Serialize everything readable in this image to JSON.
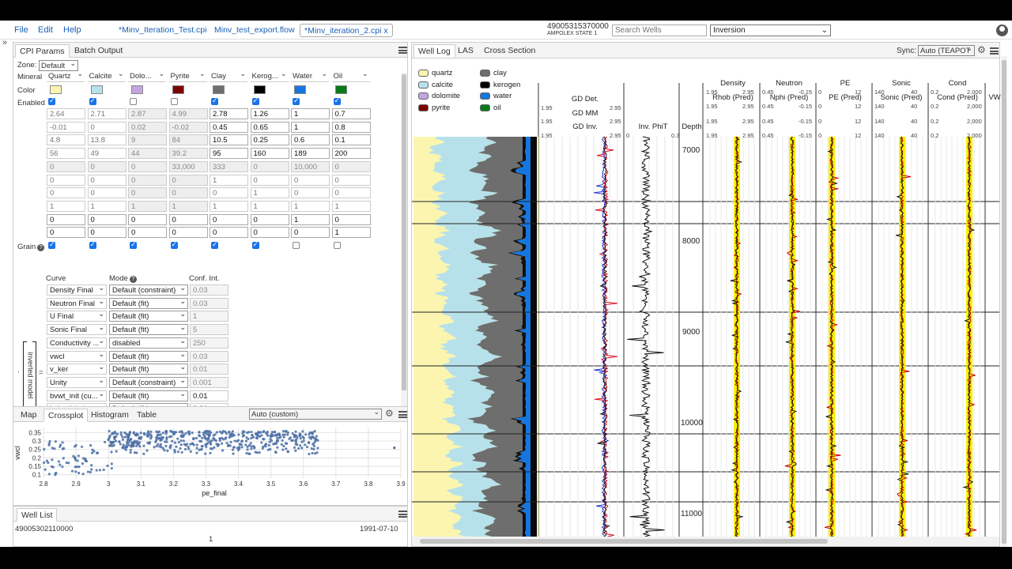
{
  "menu": {
    "file": "File",
    "edit": "Edit",
    "help": "Help"
  },
  "file_tabs": [
    "*Minv_Iteration_Test.cpi",
    "Minv_test_export.flow",
    "*Minv_iteration_2.cpi x"
  ],
  "well": {
    "id": "49005315370000",
    "name": "AMPOLEX STATE 1"
  },
  "search": {
    "placeholder": "Search Wells"
  },
  "mode_select": "Inversion",
  "left_tabs": {
    "cpi_params": "CPI Params",
    "batch_output": "Batch Output"
  },
  "zone": {
    "label": "Zone:",
    "value": "Default"
  },
  "row_labels": {
    "mineral": "Mineral",
    "color": "Color",
    "enabled": "Enabled",
    "grain": "Grain"
  },
  "minerals": [
    {
      "name": "Quartz",
      "color": "#fbf5b0",
      "enabled": true,
      "grain": true,
      "values": [
        "2.64",
        "-0.01",
        "4.8",
        "56",
        "0",
        "0",
        "0",
        "1",
        "0",
        "0"
      ]
    },
    {
      "name": "Calcite",
      "color": "#b7e1ea",
      "enabled": true,
      "grain": true,
      "values": [
        "2.71",
        "0",
        "13.8",
        "49",
        "0",
        "0",
        "0",
        "1",
        "0",
        "0"
      ]
    },
    {
      "name": "Dolo...",
      "color": "#c3a6df",
      "enabled": false,
      "grain": true,
      "values": [
        "2.87",
        "0.02",
        "9",
        "44",
        "0",
        "0",
        "0",
        "1",
        "0",
        "0"
      ]
    },
    {
      "name": "Pyrite",
      "color": "#7b0000",
      "enabled": false,
      "grain": true,
      "values": [
        "4.99",
        "-0.02",
        "84",
        "39.2",
        "33,000",
        "0",
        "0",
        "1",
        "0",
        "0"
      ]
    },
    {
      "name": "Clay",
      "color": "#6e6e6e",
      "enabled": true,
      "grain": true,
      "values": [
        "2.78",
        "0.45",
        "10.5",
        "95",
        "333",
        "1",
        "0",
        "1",
        "0",
        "0"
      ]
    },
    {
      "name": "Kerog...",
      "color": "#000000",
      "enabled": true,
      "grain": true,
      "values": [
        "1.26",
        "0.65",
        "0.25",
        "160",
        "0",
        "0",
        "1",
        "1",
        "0",
        "0"
      ]
    },
    {
      "name": "Water",
      "color": "#1676e0",
      "enabled": true,
      "grain": false,
      "values": [
        "1",
        "1",
        "0.6",
        "189",
        "10,000",
        "0",
        "0",
        "1",
        "1",
        "0"
      ]
    },
    {
      "name": "Oil",
      "color": "#0a7a1a",
      "enabled": true,
      "grain": false,
      "values": [
        "0.7",
        "0.8",
        "0.1",
        "200",
        "0",
        "0",
        "0",
        "1",
        "0",
        "1"
      ]
    }
  ],
  "curve_table": {
    "headers": {
      "curve": "Curve",
      "mode": "Mode",
      "conf": "Conf. Int."
    },
    "rows": [
      {
        "curve": "Density Final",
        "mode": "Default (constraint)",
        "conf": "0.03"
      },
      {
        "curve": "Neutron Final",
        "mode": "Default (fit)",
        "conf": "0.03"
      },
      {
        "curve": "U Final",
        "mode": "Default (fit)",
        "conf": "1"
      },
      {
        "curve": "Sonic Final",
        "mode": "Default (fit)",
        "conf": "5"
      },
      {
        "curve": "Conductivity ...",
        "mode": "disabled",
        "conf": "250"
      },
      {
        "curve": "vwcl",
        "mode": "Default (fit)",
        "conf": "0.03"
      },
      {
        "curve": "v_ker",
        "mode": "Default (fit)",
        "conf": "0.01"
      },
      {
        "curve": "Unity",
        "mode": "Default (constraint)",
        "conf": "0.001"
      },
      {
        "curve": "bvwt_init (cu...",
        "mode": "Default (fit)",
        "conf": "0.01"
      },
      {
        "curve": "bvhc_init (cu...",
        "mode": "Default (fit)",
        "conf": "0.01"
      }
    ],
    "inverted_model": "inverted model",
    "dot": "·",
    "equals": "="
  },
  "bottom_tabs": {
    "map": "Map",
    "crossplot": "Crossplot",
    "histogram": "Histogram",
    "table": "Table",
    "select": "Auto (custom)"
  },
  "chart_data": {
    "type": "scatter",
    "xlabel": "pe_final",
    "ylabel": "vwcl",
    "xlim": [
      2.8,
      3.9
    ],
    "ylim": [
      0.08,
      0.38
    ],
    "xticks": [
      "2.8",
      "2.9",
      "3",
      "3.1",
      "3.2",
      "3.3",
      "3.4",
      "3.5",
      "3.6",
      "3.7",
      "3.8",
      "3.9"
    ],
    "yticks": [
      "0.35",
      "0.3",
      "0.25",
      "0.2",
      "0.15",
      "0.1"
    ],
    "point_color": "#4a6fa5",
    "notes": "approx. 600 points; sparse cloud 2.8-3.0 at vwcl 0.1-0.3, dense band 3.0-3.65 at vwcl 0.22-0.36"
  },
  "well_list": {
    "tab": "Well List",
    "row_id": "49005302110000",
    "row_date": "1991-07-10",
    "page": "1"
  },
  "right_tabs": {
    "well_log": "Well Log",
    "las": "LAS",
    "cross_section": "Cross Section",
    "sync_label": "Sync:",
    "sync_value": "Auto (TEAPOT"
  },
  "legend": [
    {
      "name": "quartz",
      "color": "#fbf5b0"
    },
    {
      "name": "clay",
      "color": "#6e6e6e"
    },
    {
      "name": "calcite",
      "color": "#b7e1ea"
    },
    {
      "name": "kerogen",
      "color": "#000000"
    },
    {
      "name": "dolomite",
      "color": "#c3a6df"
    },
    {
      "name": "water",
      "color": "#1676e0"
    },
    {
      "name": "pyrite",
      "color": "#7b0000"
    },
    {
      "name": "oil",
      "color": "#0a7a1a"
    }
  ],
  "tracks": {
    "gd_det": "GD Det.",
    "gd_mm": "GD MM",
    "gd_inv": "GD Inv.",
    "gd_min": "1.95",
    "gd_max": "2.95",
    "inv_phit": "Inv. PhiT",
    "phit_min": "0",
    "phit_max": "0.3",
    "depth": "Depth",
    "depth_labels": [
      "7000",
      "8000",
      "9000",
      "10000",
      "11000"
    ],
    "density": "Density",
    "rhob_pred": "Rhob (Pred)",
    "dens_min": "1.95",
    "dens_max": "2.95",
    "neutron": "Neutron",
    "nphi_pred": "Nphi (Pred)",
    "neut_min": "0.45",
    "neut_max": "-0.15",
    "pe": "PE",
    "pe_pred": "PE (Pred)",
    "pe_min": "0",
    "pe_max": "12",
    "sonic": "Sonic",
    "sonic_pred": "Sonic (Pred)",
    "son_min": "140",
    "son_max": "40",
    "cond": "Cond",
    "cond_pred": "Cond (Pred)",
    "cond_min": "0.2",
    "cond_max": "2,000",
    "vw": "VW"
  }
}
